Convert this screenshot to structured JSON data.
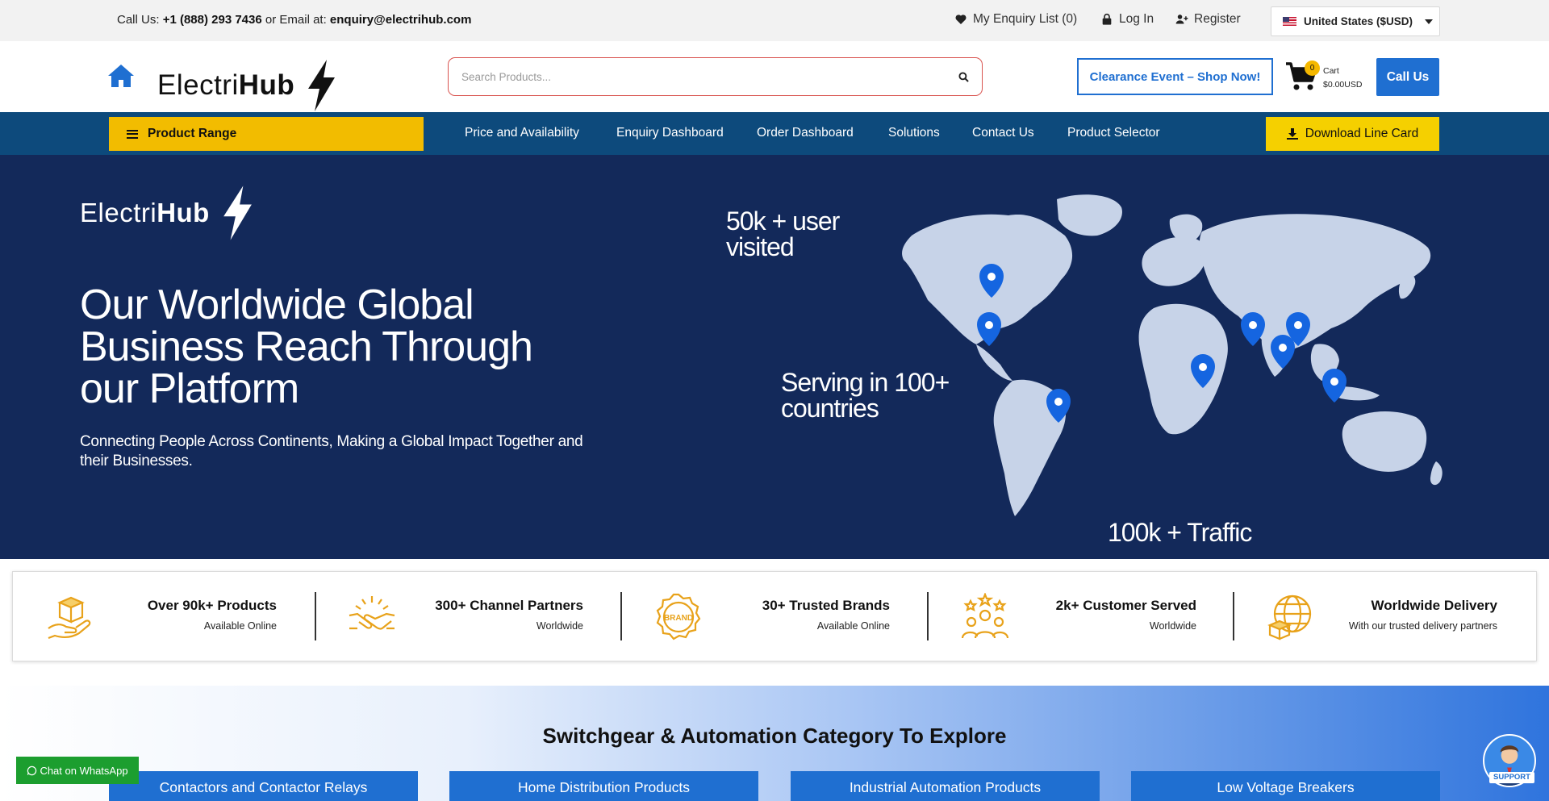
{
  "topbar": {
    "call_prefix": "Call Us: ",
    "phone": "+1 (888) 293 7436",
    "email_prefix": " or Email at: ",
    "email": "enquiry@electrihub.com",
    "enquiry_list": "My Enquiry List (0)",
    "login": "Log In",
    "register": "Register",
    "country": "United States ($USD)"
  },
  "header": {
    "brand_light": "Electri",
    "brand_bold": "Hub",
    "search_placeholder": "Search Products...",
    "clearance": "Clearance Event – Shop Now!",
    "cart_count": "0",
    "cart_label": "Cart",
    "cart_total": "$0.00USD",
    "call_us": "Call Us"
  },
  "nav": {
    "product_range": "Product Range",
    "items": [
      "Price and Availability",
      "Enquiry Dashboard",
      "Order Dashboard",
      "Solutions",
      "Contact Us",
      "Product Selector"
    ],
    "download": "Download Line Card"
  },
  "hero": {
    "brand_light": "Electri",
    "brand_bold": "Hub",
    "title": "Our Worldwide Global Business Reach Through our Platform",
    "subtitle": "Connecting People Across Continents, Making a Global Impact Together and their Businesses.",
    "stat_users": "50k + user visited",
    "stat_countries": "Serving in 100+ countries",
    "stat_traffic": "100k + Traffic"
  },
  "features": [
    {
      "title": "Over 90k+ Products",
      "subtitle": "Available Online",
      "icon": "box-hand-icon"
    },
    {
      "title": "300+ Channel Partners",
      "subtitle": "Worldwide",
      "icon": "handshake-icon"
    },
    {
      "title": "30+ Trusted Brands",
      "subtitle": "Available Online",
      "icon": "brand-badge-icon"
    },
    {
      "title": "2k+ Customer Served",
      "subtitle": "Worldwide",
      "icon": "customers-stars-icon"
    },
    {
      "title": "Worldwide Delivery",
      "subtitle": "With our trusted delivery partners",
      "icon": "globe-box-icon"
    }
  ],
  "category": {
    "title": "Switchgear & Automation Category To Explore",
    "buttons": [
      "Contactors and Contactor Relays",
      "Home Distribution Products",
      "Industrial Automation Products",
      "Low Voltage Breakers"
    ]
  },
  "whatsapp": "Chat on WhatsApp",
  "support": "SUPPORT",
  "colors": {
    "accent_blue": "#1f6fd1",
    "nav_blue": "#0d4a7c",
    "hero_navy": "#13295a",
    "yellow": "#f2bc00",
    "feature_gold": "#e8a21a",
    "whatsapp_green": "#1c9e2f"
  }
}
